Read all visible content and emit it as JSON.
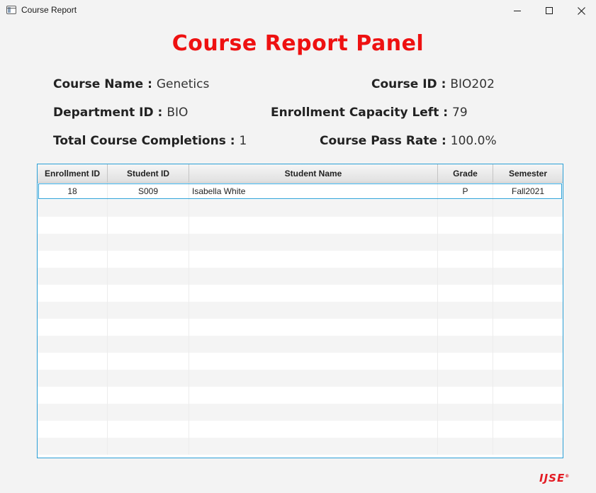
{
  "window": {
    "title": "Course Report"
  },
  "heading": "Course Report Panel",
  "info": {
    "course_name_label": "Course Name :",
    "course_name": "Genetics",
    "course_id_label": "Course ID :",
    "course_id": "BIO202",
    "department_id_label": "Department ID :",
    "department_id": "BIO",
    "capacity_left_label": "Enrollment Capacity Left :",
    "capacity_left": "79",
    "completions_label": "Total Course Completions :",
    "completions": "1",
    "pass_rate_label": "Course Pass Rate :",
    "pass_rate": "100.0%"
  },
  "table": {
    "columns": [
      "Enrollment ID",
      "Student ID",
      "Student Name",
      "Grade",
      "Semester"
    ],
    "rows": [
      [
        "18",
        "S009",
        "Isabella White",
        "P",
        "Fall2021"
      ]
    ]
  },
  "logo": "IJSE",
  "colors": {
    "accent": "#2a9fd6",
    "heading": "#ee1111",
    "logo": "#e31b23"
  }
}
